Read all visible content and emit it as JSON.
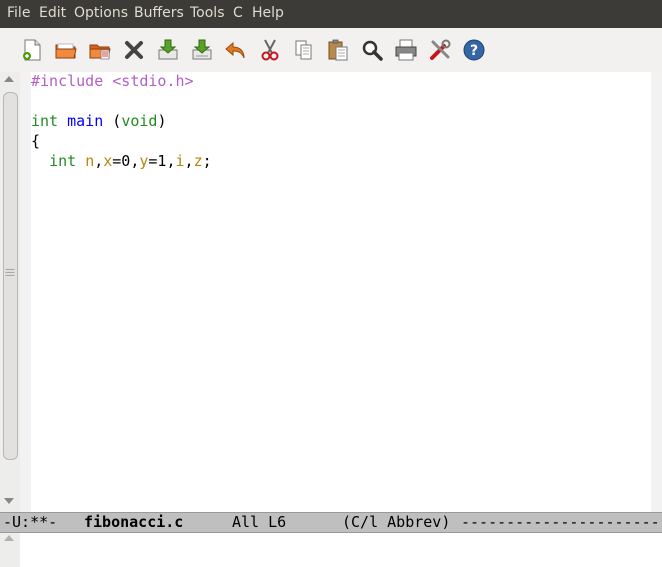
{
  "menubar": {
    "items": [
      "File",
      "Edit",
      "Options",
      "Buffers",
      "Tools",
      "C",
      "Help"
    ]
  },
  "toolbar": {
    "buttons": [
      {
        "icon": "new-file-icon"
      },
      {
        "icon": "open-folder-icon"
      },
      {
        "icon": "open-directory-icon"
      },
      {
        "icon": "close-icon"
      },
      {
        "icon": "save-icon"
      },
      {
        "icon": "save-as-icon"
      },
      {
        "icon": "undo-icon"
      },
      {
        "icon": "cut-icon"
      },
      {
        "icon": "copy-icon"
      },
      {
        "icon": "paste-icon"
      },
      {
        "icon": "search-icon"
      },
      {
        "icon": "print-icon"
      },
      {
        "icon": "preferences-icon"
      },
      {
        "icon": "help-icon"
      }
    ]
  },
  "editor": {
    "line1": {
      "directive": "#include",
      "header": "<stdio.h>"
    },
    "line3": {
      "type": "int",
      "name": "main",
      "open": "(",
      "param": "void",
      "close": ")"
    },
    "line4": {
      "brace": "{"
    },
    "line5": {
      "type": "int",
      "v1": "n",
      "c1": ",",
      "v2": "x",
      "e1": "=0,",
      "v3": "y",
      "e2": "=1,",
      "v4": "i",
      "c2": ",",
      "v5": "z",
      "end": ";"
    }
  },
  "modeline": {
    "status": "-U:**-",
    "buffer": "fibonacci.c",
    "position": "All L6",
    "mode": "(C/l Abbrev)",
    "fill": "------------------------"
  },
  "colors": {
    "menubar_bg": "#3c3b37",
    "preprocessor": "#b35fc9",
    "keyword": "#228b22",
    "function": "#0000ff",
    "variable": "#b8860b"
  }
}
